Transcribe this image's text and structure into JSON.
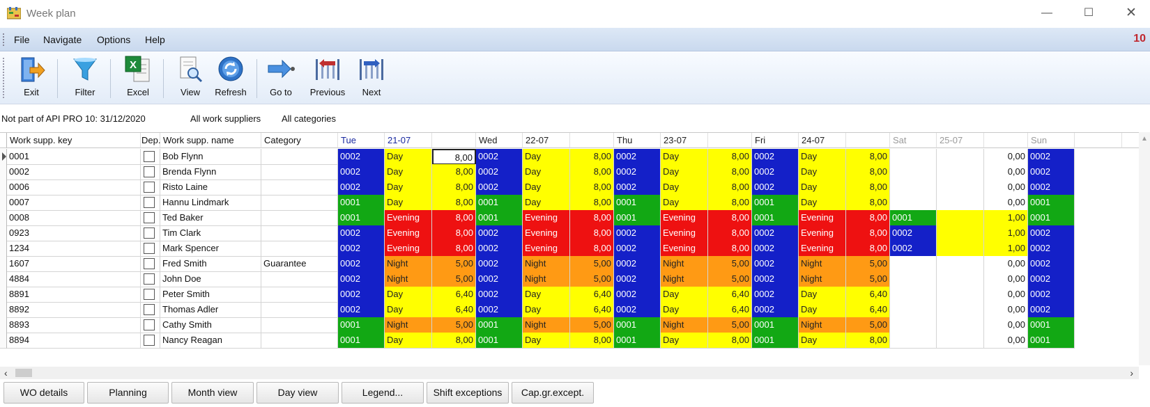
{
  "window": {
    "title": "Week plan",
    "controls": {
      "minimize": "—",
      "maximize": "☐",
      "close": "✕"
    }
  },
  "menu": {
    "items": [
      "File",
      "Navigate",
      "Options",
      "Help"
    ],
    "counter": "10"
  },
  "toolbar": {
    "buttons": [
      {
        "label": "Exit",
        "icon": "exit-icon"
      },
      {
        "label": "Filter",
        "icon": "filter-icon"
      },
      {
        "label": "Excel",
        "icon": "excel-icon"
      },
      {
        "label": "View",
        "icon": "view-icon"
      },
      {
        "label": "Refresh",
        "icon": "refresh-icon"
      },
      {
        "label": "Go to",
        "icon": "goto-icon"
      },
      {
        "label": "Previous",
        "icon": "previous-icon"
      },
      {
        "label": "Next",
        "icon": "next-icon"
      }
    ]
  },
  "info": {
    "api_text": "Not part of API PRO 10:  31/12/2020",
    "suppliers": "All work suppliers",
    "categories": "All categories"
  },
  "grid": {
    "columns": {
      "key": "Work supp. key",
      "dep": "Dep.",
      "name": "Work supp. name",
      "category": "Category"
    },
    "days": [
      {
        "day": "Tue",
        "date": "21-07"
      },
      {
        "day": "Wed",
        "date": "22-07"
      },
      {
        "day": "Thu",
        "date": "23-07"
      },
      {
        "day": "Fri",
        "date": "24-07"
      },
      {
        "day": "Sat",
        "date": "25-07"
      },
      {
        "day": "Sun",
        "date": ""
      }
    ],
    "colors": {
      "blue": "#1420c8",
      "green": "#12a814",
      "yellow": "#ffff00",
      "red": "#ee1111",
      "orange": "#ff9a14"
    },
    "rows": [
      {
        "key": "0001",
        "name": "Bob Flynn",
        "category": "",
        "weekday": {
          "code": "0002",
          "shift": "Day",
          "hours": "8,00",
          "code_color": "blue",
          "shift_color": "yellow"
        },
        "sat": {
          "code": "",
          "hours": "0,00"
        },
        "sun_code": "0002",
        "sun_color": "blue"
      },
      {
        "key": "0002",
        "name": "Brenda Flynn",
        "category": "",
        "weekday": {
          "code": "0002",
          "shift": "Day",
          "hours": "8,00",
          "code_color": "blue",
          "shift_color": "yellow"
        },
        "sat": {
          "code": "",
          "hours": "0,00"
        },
        "sun_code": "0002",
        "sun_color": "blue"
      },
      {
        "key": "0006",
        "name": "Risto Laine",
        "category": "",
        "weekday": {
          "code": "0002",
          "shift": "Day",
          "hours": "8,00",
          "code_color": "blue",
          "shift_color": "yellow"
        },
        "sat": {
          "code": "",
          "hours": "0,00"
        },
        "sun_code": "0002",
        "sun_color": "blue"
      },
      {
        "key": "0007",
        "name": "Hannu Lindmark",
        "category": "",
        "weekday": {
          "code": "0001",
          "shift": "Day",
          "hours": "8,00",
          "code_color": "green",
          "shift_color": "yellow"
        },
        "sat": {
          "code": "",
          "hours": "0,00"
        },
        "sun_code": "0001",
        "sun_color": "green"
      },
      {
        "key": "0008",
        "name": "Ted Baker",
        "category": "",
        "weekday": {
          "code": "0001",
          "shift": "Evening",
          "hours": "8,00",
          "code_color": "green",
          "shift_color": "red"
        },
        "sat": {
          "code": "0001",
          "hours": "1,00",
          "code_color": "green"
        },
        "sun_code": "0001",
        "sun_color": "green"
      },
      {
        "key": "0923",
        "name": "Tim Clark",
        "category": "",
        "weekday": {
          "code": "0002",
          "shift": "Evening",
          "hours": "8,00",
          "code_color": "blue",
          "shift_color": "red"
        },
        "sat": {
          "code": "0002",
          "hours": "1,00",
          "code_color": "blue"
        },
        "sun_code": "0002",
        "sun_color": "blue"
      },
      {
        "key": "1234",
        "name": "Mark Spencer",
        "category": "",
        "weekday": {
          "code": "0002",
          "shift": "Evening",
          "hours": "8,00",
          "code_color": "blue",
          "shift_color": "red"
        },
        "sat": {
          "code": "0002",
          "hours": "1,00",
          "code_color": "blue"
        },
        "sun_code": "0002",
        "sun_color": "blue"
      },
      {
        "key": "1607",
        "name": "Fred Smith",
        "category": "Guarantee",
        "weekday": {
          "code": "0002",
          "shift": "Night",
          "hours": "5,00",
          "code_color": "blue",
          "shift_color": "orange"
        },
        "sat": {
          "code": "",
          "hours": "0,00"
        },
        "sun_code": "0002",
        "sun_color": "blue"
      },
      {
        "key": "4884",
        "name": "John Doe",
        "category": "",
        "weekday": {
          "code": "0002",
          "shift": "Night",
          "hours": "5,00",
          "code_color": "blue",
          "shift_color": "orange"
        },
        "sat": {
          "code": "",
          "hours": "0,00"
        },
        "sun_code": "0002",
        "sun_color": "blue"
      },
      {
        "key": "8891",
        "name": "Peter Smith",
        "category": "",
        "weekday": {
          "code": "0002",
          "shift": "Day",
          "hours": "6,40",
          "code_color": "blue",
          "shift_color": "yellow"
        },
        "sat": {
          "code": "",
          "hours": "0,00"
        },
        "sun_code": "0002",
        "sun_color": "blue"
      },
      {
        "key": "8892",
        "name": "Thomas Adler",
        "category": "",
        "weekday": {
          "code": "0002",
          "shift": "Day",
          "hours": "6,40",
          "code_color": "blue",
          "shift_color": "yellow"
        },
        "sat": {
          "code": "",
          "hours": "0,00"
        },
        "sun_code": "0002",
        "sun_color": "blue"
      },
      {
        "key": "8893",
        "name": "Cathy Smith",
        "category": "",
        "weekday": {
          "code": "0001",
          "shift": "Night",
          "hours": "5,00",
          "code_color": "green",
          "shift_color": "orange"
        },
        "sat": {
          "code": "",
          "hours": "0,00"
        },
        "sun_code": "0001",
        "sun_color": "green"
      },
      {
        "key": "8894",
        "name": "Nancy Reagan",
        "category": "",
        "weekday": {
          "code": "0001",
          "shift": "Day",
          "hours": "8,00",
          "code_color": "green",
          "shift_color": "yellow"
        },
        "sat": {
          "code": "",
          "hours": "0,00"
        },
        "sun_code": "0001",
        "sun_color": "green"
      }
    ]
  },
  "bottom_buttons": [
    "WO details",
    "Planning",
    "Month view",
    "Day view",
    "Legend...",
    "Shift exceptions",
    "Cap.gr.except."
  ]
}
